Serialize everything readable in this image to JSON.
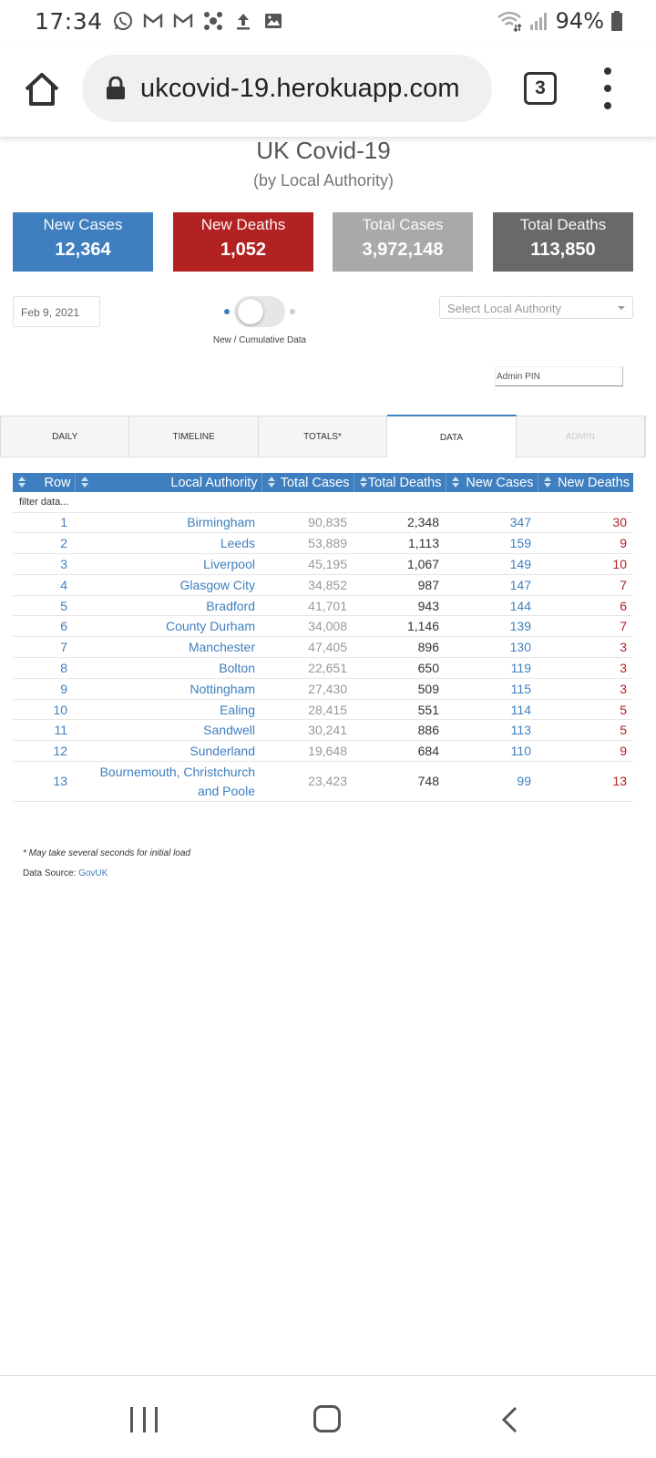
{
  "status_bar": {
    "time": "17:34",
    "icons": [
      "whatsapp-icon",
      "gmail-icon",
      "gmail-icon",
      "apps-icon",
      "upload-icon",
      "image-icon"
    ],
    "battery_text": "94%"
  },
  "browser": {
    "url": "ukcovid-19.herokuapp.com",
    "tab_count": "3"
  },
  "page": {
    "title": "UK Covid-19",
    "subtitle": "(by Local Authority)"
  },
  "stats": {
    "new_cases": {
      "label": "New Cases",
      "value": "12,364",
      "color": "#3f7fbf"
    },
    "new_deaths": {
      "label": "New Deaths",
      "value": "1,052",
      "color": "#b22222"
    },
    "total_cases": {
      "label": "Total Cases",
      "value": "3,972,148",
      "color": "#a9a9a9"
    },
    "total_deaths": {
      "label": "Total Deaths",
      "value": "113,850",
      "color": "#696969"
    }
  },
  "controls": {
    "date": "Feb 9, 2021",
    "toggle_label": "New / Cumulative Data",
    "select_placeholder": "Select Local Authority",
    "admin_pin_placeholder": "Admin PIN"
  },
  "tabs": [
    {
      "label": "DAILY",
      "active": false,
      "disabled": false
    },
    {
      "label": "TIMELINE",
      "active": false,
      "disabled": false
    },
    {
      "label": "TOTALS*",
      "active": false,
      "disabled": false
    },
    {
      "label": "DATA",
      "active": true,
      "disabled": false
    },
    {
      "label": "ADMIN",
      "active": false,
      "disabled": true
    }
  ],
  "table": {
    "headers": [
      "Row",
      "Local Authority",
      "Total Cases",
      "Total Deaths",
      "New Cases",
      "New Deaths"
    ],
    "filter_placeholder": "filter data...",
    "rows": [
      [
        "1",
        "Birmingham",
        "90,835",
        "2,348",
        "347",
        "30"
      ],
      [
        "2",
        "Leeds",
        "53,889",
        "1,113",
        "159",
        "9"
      ],
      [
        "3",
        "Liverpool",
        "45,195",
        "1,067",
        "149",
        "10"
      ],
      [
        "4",
        "Glasgow City",
        "34,852",
        "987",
        "147",
        "7"
      ],
      [
        "5",
        "Bradford",
        "41,701",
        "943",
        "144",
        "6"
      ],
      [
        "6",
        "County Durham",
        "34,008",
        "1,146",
        "139",
        "7"
      ],
      [
        "7",
        "Manchester",
        "47,405",
        "896",
        "130",
        "3"
      ],
      [
        "8",
        "Bolton",
        "22,651",
        "650",
        "119",
        "3"
      ],
      [
        "9",
        "Nottingham",
        "27,430",
        "509",
        "115",
        "3"
      ],
      [
        "10",
        "Ealing",
        "28,415",
        "551",
        "114",
        "5"
      ],
      [
        "11",
        "Sandwell",
        "30,241",
        "886",
        "113",
        "5"
      ],
      [
        "12",
        "Sunderland",
        "19,648",
        "684",
        "110",
        "9"
      ],
      [
        "13",
        "Bournemouth, Christchurch and Poole",
        "23,423",
        "748",
        "99",
        "13"
      ]
    ]
  },
  "footer": {
    "note": "* May take several seconds for initial load",
    "source_label": "Data Source:",
    "source_link": "GovUK"
  },
  "nav": {
    "icons": [
      "recents-icon",
      "home-icon",
      "back-icon"
    ]
  }
}
